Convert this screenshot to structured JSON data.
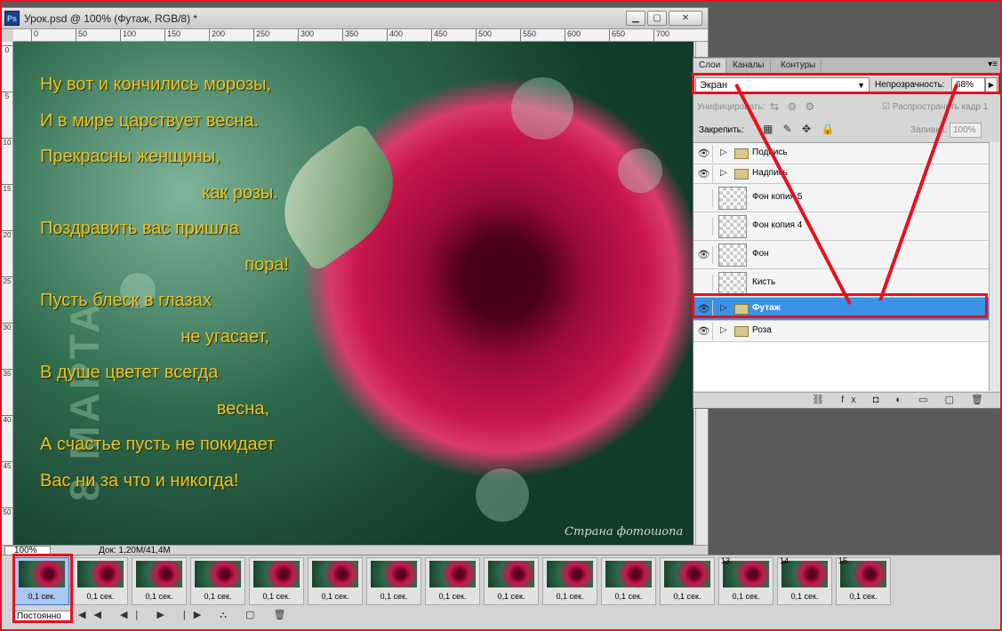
{
  "document": {
    "title": "Урок.psd @ 100% (Футаж, RGB/8) *",
    "ps_badge": "Ps",
    "ruler_top_ticks": [
      "0",
      "50",
      "100",
      "150",
      "200",
      "250",
      "300",
      "350",
      "400",
      "450",
      "500",
      "550",
      "600",
      "650",
      "700"
    ],
    "ruler_left_ticks": [
      "0",
      "5",
      "10",
      "15",
      "20",
      "25",
      "30",
      "35",
      "40",
      "45",
      "50"
    ],
    "zoom": "100%",
    "doc_size": "Док: 1,20M/41,4M",
    "poem": [
      "Ну вот и кончились морозы,",
      "И в мире царствует весна.",
      "Прекрасны женщины,",
      "как розы.",
      "Поздравить вас пришла",
      "пора!",
      "Пусть блеск в глазах",
      "не угасает,",
      "В душе цветет всегда",
      "весна,",
      "А счастье пусть не покидает",
      "Вас ни за что и никогда!"
    ],
    "vertical_text": "8 МАРТА",
    "watermark": "Страна фотошопа"
  },
  "layers_panel": {
    "tabs": [
      "Слои",
      "Каналы",
      "Контуры"
    ],
    "blend_mode": "Экран",
    "opacity_label": "Непрозрачность:",
    "opacity_value": "68%",
    "unify_label": "Унифицировать:",
    "unify_icons": "⇆ ⚙ ⚙",
    "propagate_label": "☑ Распространить кадр 1",
    "lock_label": "Закрепить:",
    "lock_icons": "▦ ✎ ✥ 🔒",
    "fill_label": "Заливка:",
    "fill_value": "100%",
    "layers": [
      {
        "name": "Подпись",
        "type": "group",
        "visible": true,
        "selected": false
      },
      {
        "name": "Надпись",
        "type": "group",
        "visible": true,
        "selected": false
      },
      {
        "name": "Фон копия 5",
        "type": "layer",
        "visible": false,
        "selected": false
      },
      {
        "name": "Фон копия 4",
        "type": "layer",
        "visible": false,
        "selected": false
      },
      {
        "name": "Фон",
        "type": "layer",
        "visible": true,
        "selected": false
      },
      {
        "name": "Кисть",
        "type": "layer",
        "visible": false,
        "selected": false
      },
      {
        "name": "Футаж",
        "type": "group",
        "visible": true,
        "selected": true
      },
      {
        "name": "Роза",
        "type": "group",
        "visible": true,
        "selected": false
      }
    ],
    "bottom_icons": "⛓ fx ◘ ◐ ▭ ▢ 🗑"
  },
  "timeline": {
    "frames": [
      {
        "num": "",
        "duration": "0,1 сек.",
        "selected": true
      },
      {
        "num": "",
        "duration": "0,1 сек.",
        "selected": false
      },
      {
        "num": "",
        "duration": "0,1 сек.",
        "selected": false
      },
      {
        "num": "",
        "duration": "0,1 сек.",
        "selected": false
      },
      {
        "num": "",
        "duration": "0,1 сек.",
        "selected": false
      },
      {
        "num": "",
        "duration": "0,1 сек.",
        "selected": false
      },
      {
        "num": "",
        "duration": "0,1 сек.",
        "selected": false
      },
      {
        "num": "",
        "duration": "0,1 сек.",
        "selected": false
      },
      {
        "num": "",
        "duration": "0,1 сек.",
        "selected": false
      },
      {
        "num": "",
        "duration": "0,1 сек.",
        "selected": false
      },
      {
        "num": "",
        "duration": "0,1 сек.",
        "selected": false
      },
      {
        "num": "",
        "duration": "0,1 сек.",
        "selected": false
      },
      {
        "num": "13",
        "duration": "0,1 сек.",
        "selected": false
      },
      {
        "num": "14",
        "duration": "0,1 сек.",
        "selected": false
      },
      {
        "num": "15",
        "duration": "0,1 сек.",
        "selected": false
      }
    ],
    "loop": "Постоянно",
    "controls": "◀◀ ◀| ▶ |▶ ⛬ ▢ 🗑"
  },
  "colors": {
    "annotation_red": "#e8101e",
    "selected_layer": "#3b91e6",
    "poem_text": "#e7c22c"
  },
  "icons": [
    "photoshop-icon",
    "minimize-icon",
    "maximize-icon",
    "close-icon",
    "eye-icon",
    "folder-icon",
    "dropdown-arrow-icon",
    "link-icon",
    "trash-icon"
  ]
}
